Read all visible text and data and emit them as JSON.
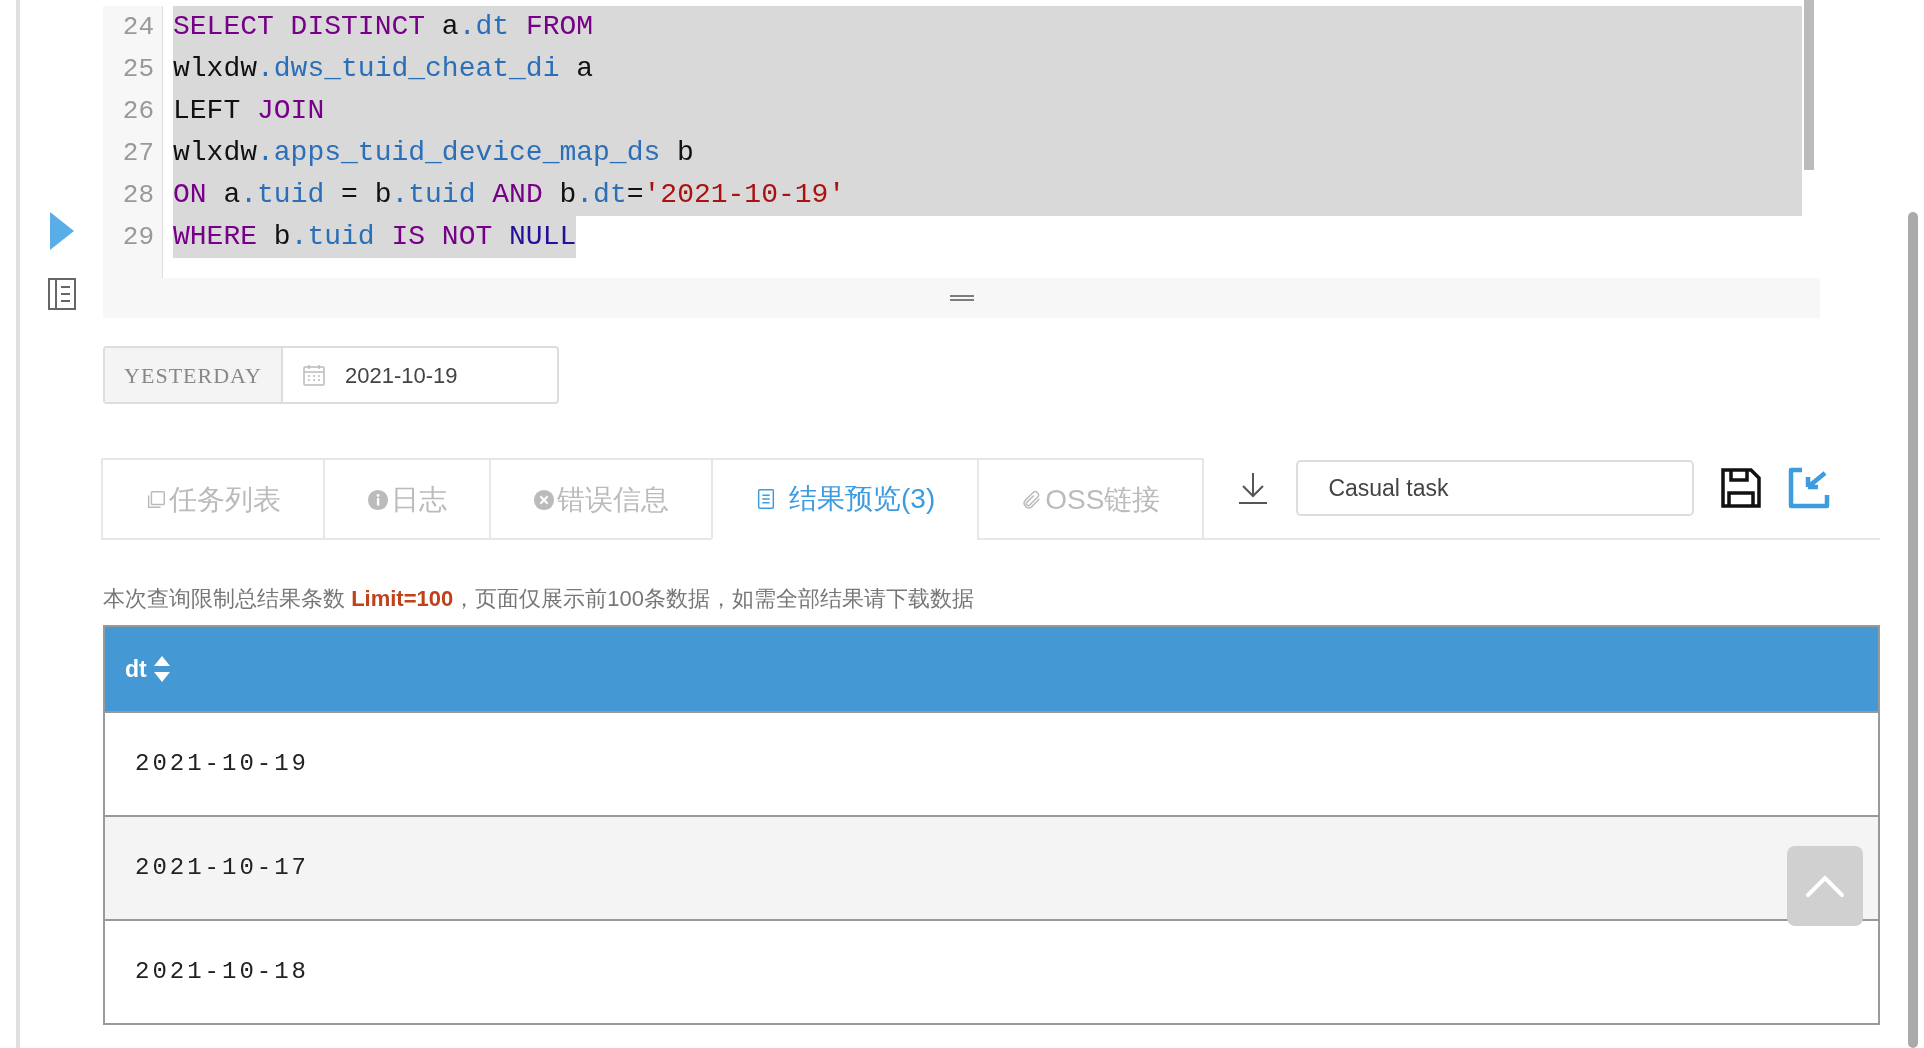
{
  "editor": {
    "lines": [
      {
        "number": "24",
        "full_line": true,
        "tokens": [
          {
            "kind": "keyword",
            "text": "SELECT DISTINCT"
          },
          {
            "kind": "plain",
            "text": " a"
          },
          {
            "kind": "field",
            "text": ".dt"
          },
          {
            "kind": "keyword",
            "text": " FROM"
          }
        ]
      },
      {
        "number": "25",
        "full_line": true,
        "tokens": [
          {
            "kind": "plain",
            "text": "wlxdw"
          },
          {
            "kind": "field",
            "text": ".dws_tuid_cheat_di"
          },
          {
            "kind": "plain",
            "text": " a"
          }
        ]
      },
      {
        "number": "26",
        "full_line": true,
        "tokens": [
          {
            "kind": "plain",
            "text": "LEFT "
          },
          {
            "kind": "keyword",
            "text": "JOIN"
          }
        ]
      },
      {
        "number": "27",
        "full_line": true,
        "tokens": [
          {
            "kind": "plain",
            "text": "wlxdw"
          },
          {
            "kind": "field",
            "text": ".apps_tuid_device_map_ds"
          },
          {
            "kind": "plain",
            "text": " b"
          }
        ]
      },
      {
        "number": "28",
        "full_line": true,
        "tokens": [
          {
            "kind": "keyword",
            "text": "ON"
          },
          {
            "kind": "plain",
            "text": " a"
          },
          {
            "kind": "field",
            "text": ".tuid"
          },
          {
            "kind": "plain",
            "text": " = b"
          },
          {
            "kind": "field",
            "text": ".tuid"
          },
          {
            "kind": "keyword",
            "text": " AND"
          },
          {
            "kind": "plain",
            "text": " b"
          },
          {
            "kind": "field",
            "text": ".dt"
          },
          {
            "kind": "plain",
            "text": "="
          },
          {
            "kind": "string",
            "text": "'2021-10-19'"
          }
        ]
      },
      {
        "number": "29",
        "full_line": false,
        "tokens": [
          {
            "kind": "keyword",
            "text": "WHERE"
          },
          {
            "kind": "plain",
            "text": " b"
          },
          {
            "kind": "field",
            "text": ".tuid"
          },
          {
            "kind": "keyword",
            "text": " IS NOT"
          },
          {
            "kind": "atom",
            "text": " NULL"
          }
        ]
      }
    ]
  },
  "date_bar": {
    "label": "YESTERDAY",
    "value": "2021-10-19"
  },
  "tabs": [
    {
      "kind": "list",
      "label": "任务列表",
      "selected": false
    },
    {
      "kind": "info",
      "label": "日志",
      "selected": false
    },
    {
      "kind": "error",
      "label": "错误信息",
      "selected": false
    },
    {
      "kind": "result",
      "label": "结果预览(3)",
      "selected": true
    },
    {
      "kind": "link",
      "label": "OSS链接",
      "selected": false
    }
  ],
  "task_name": {
    "value": "Casual task"
  },
  "notice": "本次查询限制总结果条数 **Limit=100**，页面仅展示前100条数据，如需全部结果请下载数据",
  "table": {
    "columns": [
      "dt"
    ],
    "rows": [
      [
        "2021-10-19"
      ],
      [
        "2021-10-17"
      ],
      [
        "2021-10-18"
      ]
    ]
  }
}
